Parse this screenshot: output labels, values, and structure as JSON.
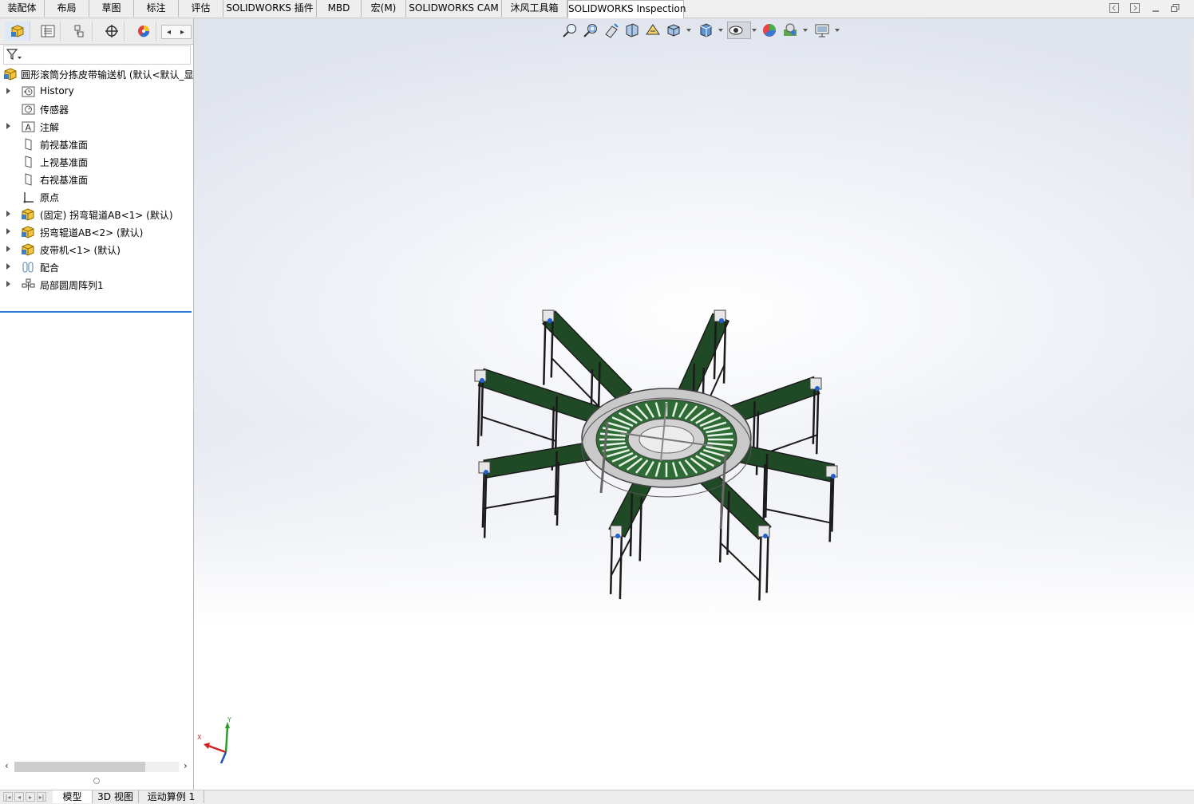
{
  "command_tabs": [
    {
      "label": "装配体"
    },
    {
      "label": "布局"
    },
    {
      "label": "草图"
    },
    {
      "label": "标注"
    },
    {
      "label": "评估"
    },
    {
      "label": "SOLIDWORKS 插件"
    },
    {
      "label": "MBD"
    },
    {
      "label": "宏(M)"
    },
    {
      "label": "SOLIDWORKS CAM"
    },
    {
      "label": "沐风工具箱"
    },
    {
      "label": "SOLIDWORKS Inspection"
    }
  ],
  "active_command_tab": "SOLIDWORKS Inspection",
  "window_controls": [
    "tile-left-icon",
    "tile-right-icon",
    "minimize-icon",
    "restore-icon"
  ],
  "panel_tabs": [
    "featuremanager-icon",
    "propertymanager-icon",
    "configurationmanager-icon",
    "dimxpert-icon",
    "display-manager-icon"
  ],
  "feature_tree": {
    "root": "圆形滚筒分拣皮带输送机  (默认<默认_显",
    "items": [
      {
        "label": "History",
        "icon": "history-icon",
        "expandable": true
      },
      {
        "label": "传感器",
        "icon": "sensor-icon",
        "expandable": false
      },
      {
        "label": "注解",
        "icon": "annotation-icon",
        "expandable": true
      },
      {
        "label": "前视基准面",
        "icon": "plane-icon",
        "expandable": false
      },
      {
        "label": "上视基准面",
        "icon": "plane-icon",
        "expandable": false
      },
      {
        "label": "右视基准面",
        "icon": "plane-icon",
        "expandable": false
      },
      {
        "label": "原点",
        "icon": "origin-icon",
        "expandable": false
      },
      {
        "label": "(固定) 拐弯辊道AB<1> (默认)",
        "icon": "subassembly-icon",
        "expandable": true
      },
      {
        "label": "拐弯辊道AB<2> (默认)",
        "icon": "subassembly-icon",
        "expandable": true
      },
      {
        "label": "皮带机<1> (默认)",
        "icon": "subassembly-icon",
        "expandable": true
      },
      {
        "label": "配合",
        "icon": "mates-icon",
        "expandable": true
      },
      {
        "label": "局部圆周阵列1",
        "icon": "circular-pattern-icon",
        "expandable": true
      }
    ]
  },
  "bottom_tabs": [
    {
      "label": "模型"
    },
    {
      "label": "3D 视图"
    },
    {
      "label": "运动算例 1"
    }
  ],
  "active_bottom_tab": "模型",
  "heads_up_toolbar": [
    "zoom-to-fit-icon",
    "zoom-to-area-icon",
    "previous-view-icon",
    "section-view-icon",
    "dynamic-annotation-icon",
    "view-orientation-icon",
    "display-style-icon",
    "hide-show-items-icon",
    "edit-appearance-icon",
    "apply-scene-icon",
    "view-settings-icon"
  ],
  "triad": {
    "x": "X",
    "y": "Y"
  },
  "colors": {
    "belt_green": "#1f4a25",
    "frame_dark": "#1b1b1b",
    "ring_gray": "#b5b5b5",
    "accent_blue": "#2a7fd4"
  }
}
